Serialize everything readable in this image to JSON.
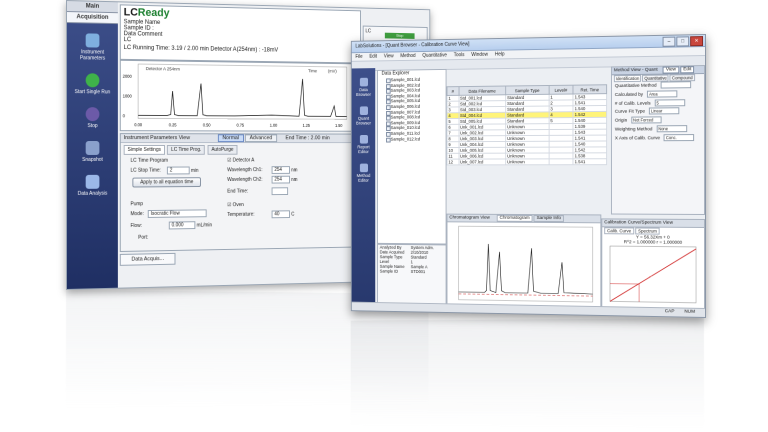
{
  "left_window": {
    "tabs": [
      "Main",
      "Acquisition"
    ],
    "sidebar": [
      {
        "label": "Instrument Parameters",
        "icon": "instrument-icon"
      },
      {
        "label": "Start Single Run",
        "icon": "start-run-icon"
      },
      {
        "label": "Stop",
        "icon": "stop-icon"
      },
      {
        "label": "Snapshot",
        "icon": "snapshot-icon"
      },
      {
        "label": "Data Analysis",
        "icon": "data-analysis-icon"
      }
    ],
    "status": {
      "state_prefix": "LC",
      "state": "Ready",
      "sample_name": "Sample Name",
      "sample_id": "Sample ID :",
      "data_comment": "Data Comment",
      "unit": "LC",
      "running_time": "LC Running Time: 3.19 / 2.00 min   Detector A(254nm) : -18mV"
    },
    "chromatogram": {
      "legend": "Detector A 254nm",
      "x_ticks": [
        "0.00",
        "0.25",
        "0.50",
        "0.75",
        "1.00",
        "1.25",
        "1.50"
      ],
      "y_ticks": [
        "0",
        "1000",
        "2000"
      ],
      "time_label": "Time",
      "right_label": "(mV)"
    },
    "side_panel": {
      "title": "LC",
      "label": "Stop",
      "btn": "Save..."
    },
    "params": {
      "title": "Instrument Parameters View",
      "modes": [
        "Normal",
        "Advanced"
      ],
      "end_time": "End Time : 2.00 min",
      "tabs": [
        "Simple Settings",
        "LC Time Prog.",
        "AutoPurge"
      ],
      "time_program": "LC Time Program",
      "stop_time_label": "LC Stop Time:",
      "stop_time_value": "2",
      "stop_time_unit": "min",
      "apply_btn": "Apply to all equation time",
      "pump": "Pump",
      "mode_label": "Mode:",
      "mode_value": "Isocratic Flow",
      "flow_label": "Flow:",
      "flow_value": "0.000",
      "flow_unit": "mL/min",
      "port_label": "Port:",
      "detector": "Detector A",
      "wl_ch1_label": "Wavelength Ch1:",
      "wl_ch1": "254",
      "wl_ch2_label": "Wavelength Ch2:",
      "wl_ch2": "254",
      "nm": "nm",
      "end_time_label": "End Time:",
      "oven": "Oven",
      "temp_label": "Temperature:",
      "temp_value": "40",
      "temp_unit": "C"
    },
    "bottom_tab": "Data Acquis..."
  },
  "right_window": {
    "title": "LabSolutions - [Quant Browser - Calibration Curve View]",
    "menus": [
      "File",
      "Edit",
      "View",
      "Method",
      "Quantitative",
      "Tools",
      "Window",
      "Help"
    ],
    "nav": [
      "Data Browser",
      "Quant Browser",
      "Report Editor",
      "Method Editor"
    ],
    "tree_root": "Data Explorer",
    "tree_items": [
      "Sample_001.lcd",
      "Sample_002.lcd",
      "Sample_003.lcd",
      "Sample_004.lcd",
      "Sample_005.lcd",
      "Sample_006.lcd",
      "Sample_007.lcd",
      "Sample_008.lcd",
      "Sample_009.lcd",
      "Sample_010.lcd",
      "Sample_011.lcd",
      "Sample_012.lcd"
    ],
    "table": {
      "headers": [
        "#",
        "Data Filename",
        "Sample Type",
        "Level#",
        "Ret. Time"
      ],
      "rows": [
        [
          "1",
          "Std_001.lcd",
          "Standard",
          "1",
          "1.543"
        ],
        [
          "2",
          "Std_002.lcd",
          "Standard",
          "2",
          "1.541"
        ],
        [
          "3",
          "Std_003.lcd",
          "Standard",
          "3",
          "1.540"
        ],
        [
          "4",
          "Std_004.lcd",
          "Standard",
          "4",
          "1.542"
        ],
        [
          "5",
          "Std_005.lcd",
          "Standard",
          "5",
          "1.540"
        ],
        [
          "6",
          "Unk_001.lcd",
          "Unknown",
          "",
          "1.539"
        ],
        [
          "7",
          "Unk_002.lcd",
          "Unknown",
          "",
          "1.543"
        ],
        [
          "8",
          "Unk_003.lcd",
          "Unknown",
          "",
          "1.541"
        ],
        [
          "9",
          "Unk_004.lcd",
          "Unknown",
          "",
          "1.540"
        ],
        [
          "10",
          "Unk_005.lcd",
          "Unknown",
          "",
          "1.542"
        ],
        [
          "11",
          "Unk_006.lcd",
          "Unknown",
          "",
          "1.538"
        ],
        [
          "12",
          "Unk_007.lcd",
          "Unknown",
          "",
          "1.541"
        ]
      ],
      "selected_row": 3
    },
    "method": {
      "title": "Method View - Quant",
      "buttons": [
        "View",
        "Edit"
      ],
      "tabs": [
        "Identification",
        "Quantitative",
        "Compound"
      ],
      "fields": [
        [
          "Quantitative Method",
          ""
        ],
        [
          "Calculated by",
          "Area"
        ],
        [
          "# of Calib. Levels",
          "5"
        ],
        [
          "Curve Fit Type",
          "Linear"
        ],
        [
          "Origin",
          "Not Forced"
        ],
        [
          "Weighting Method",
          "None"
        ],
        [
          "X Axis of Calib. Curve",
          "Conc."
        ]
      ]
    },
    "chrom_panel": {
      "title": "Chromatogram View",
      "tabs": [
        "Chromatogram",
        "Sample Info"
      ]
    },
    "calib_panel": {
      "title": "Calibration Curve/Spectrum View",
      "tabs": [
        "Calib. Curve",
        "Spectrum"
      ],
      "eq1": "Y = 56.32Xm + 0",
      "eq2": "R^2 = 1.000000   r = 1.000000"
    },
    "info_panel": [
      [
        "Analyzed By",
        "System Adm."
      ],
      [
        "Date Acquired",
        "2/10/2010"
      ],
      [
        "Sample Type",
        "Standard"
      ],
      [
        "Level",
        "1"
      ],
      [
        "Sample Name",
        "Sample A"
      ],
      [
        "Sample ID",
        "STD001"
      ]
    ],
    "status_bar": [
      "CAP",
      "NUM"
    ]
  },
  "colors": {
    "nav_blue": "#2f4178",
    "ready_green": "#1a7f2e",
    "selected_row": "#fff47a",
    "calib_red": "#d12a2a"
  }
}
